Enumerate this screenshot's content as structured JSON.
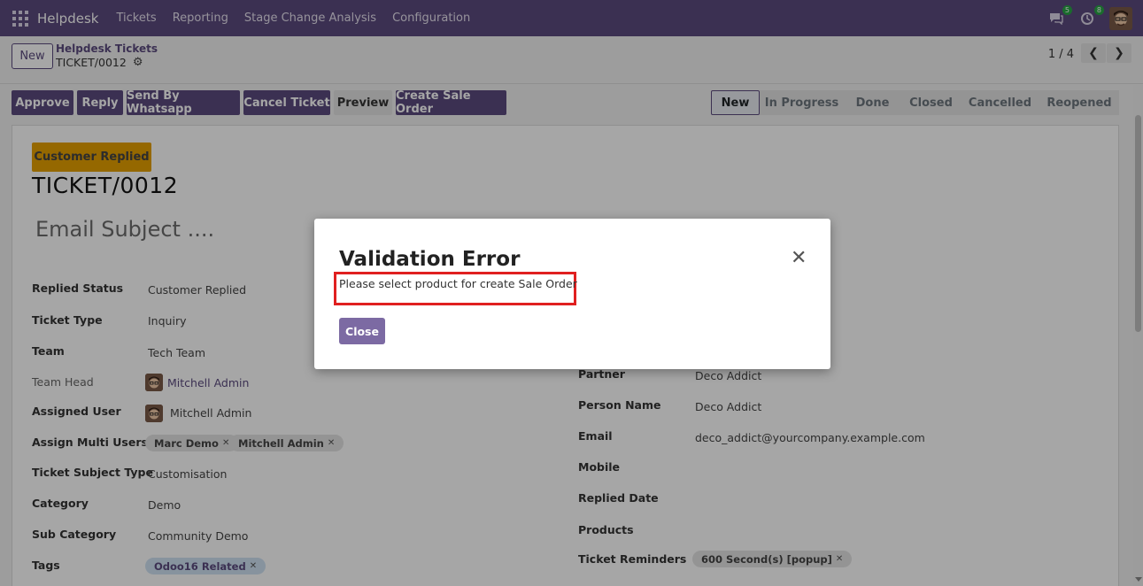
{
  "navbar": {
    "brand": "Helpdesk",
    "menu": [
      "Tickets",
      "Reporting",
      "Stage Change Analysis",
      "Configuration"
    ],
    "messages_badge": "5",
    "activities_badge": "8"
  },
  "control_panel": {
    "new_label": "New",
    "breadcrumb_parent": "Helpdesk Tickets",
    "breadcrumb_current": "TICKET/0012",
    "pager": "1 / 4"
  },
  "actions": {
    "approve": "Approve",
    "reply": "Reply",
    "send_whatsapp": "Send By Whatsapp",
    "cancel_ticket": "Cancel Ticket",
    "preview": "Preview",
    "create_sale_order": "Create Sale Order"
  },
  "stages": [
    "New",
    "In Progress",
    "Done",
    "Closed",
    "Cancelled",
    "Reopened"
  ],
  "active_stage": "New",
  "form": {
    "ribbon": "Customer Replied",
    "ticket_name": "TICKET/0012",
    "email_subject_placeholder": "Email Subject ....",
    "left_fields": {
      "replied_status": {
        "label": "Replied Status",
        "value": "Customer Replied"
      },
      "ticket_type": {
        "label": "Ticket Type",
        "value": "Inquiry"
      },
      "team": {
        "label": "Team",
        "value": "Tech Team"
      },
      "team_head": {
        "label": "Team Head",
        "value": "Mitchell Admin"
      },
      "assigned_user": {
        "label": "Assigned User",
        "value": "Mitchell Admin"
      },
      "assign_multi_users": {
        "label": "Assign Multi Users",
        "tags": [
          "Marc Demo",
          "Mitchell Admin"
        ]
      },
      "ticket_subject_type": {
        "label": "Ticket Subject Type",
        "value": "Customisation"
      },
      "category": {
        "label": "Category",
        "value": "Demo"
      },
      "sub_category": {
        "label": "Sub Category",
        "value": "Community Demo"
      },
      "tags": {
        "label": "Tags",
        "tags": [
          "Odoo16 Related"
        ]
      }
    },
    "right_fields": {
      "partner": {
        "label": "Partner",
        "value": "Deco Addict"
      },
      "person_name": {
        "label": "Person Name",
        "value": "Deco Addict"
      },
      "email": {
        "label": "Email",
        "value": "deco_addict@yourcompany.example.com"
      },
      "mobile": {
        "label": "Mobile",
        "value": ""
      },
      "replied_date": {
        "label": "Replied Date",
        "value": ""
      },
      "products": {
        "label": "Products",
        "value": ""
      },
      "ticket_reminders": {
        "label": "Ticket Reminders",
        "tags": [
          "600 Second(s) [popup]"
        ]
      }
    }
  },
  "dialog": {
    "title": "Validation Error",
    "message": "Please select product for create Sale Order",
    "close_label": "Close",
    "highlight_color": "#e02020"
  },
  "colors": {
    "brand": "#5b4a7e",
    "ribbon": "#e5a000"
  }
}
